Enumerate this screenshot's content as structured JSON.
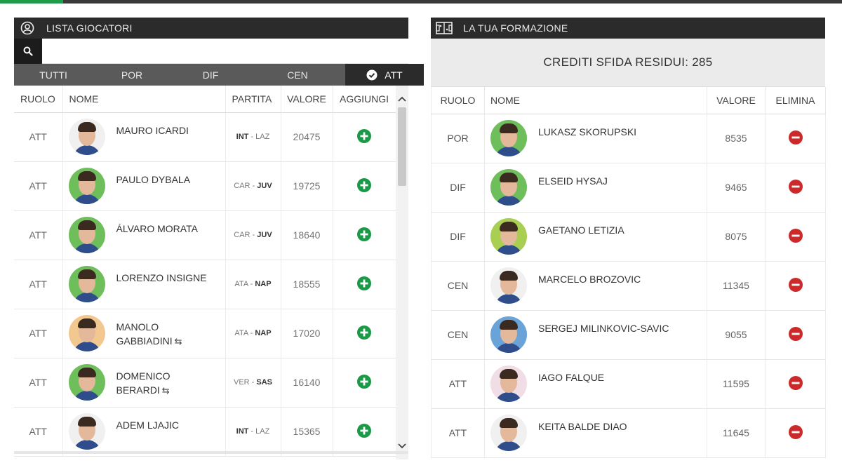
{
  "colors": {
    "accent": "#1e9c4a",
    "add": "#1a9a46",
    "remove": "#cc2a2a",
    "dark": "#2b2b2b"
  },
  "player_list": {
    "title": "LISTA GIOCATORI",
    "search_placeholder": "",
    "filters": [
      {
        "label": "TUTTI",
        "active": false
      },
      {
        "label": "POR",
        "active": false
      },
      {
        "label": "DIF",
        "active": false
      },
      {
        "label": "CEN",
        "active": false
      },
      {
        "label": "ATT",
        "active": true
      }
    ],
    "columns": [
      "RUOLO",
      "NOME",
      "PARTITA",
      "VALORE",
      "AGGIUNGI"
    ],
    "rows": [
      {
        "role": "ATT",
        "name": "MAURO ICARDI",
        "name2": "",
        "swap": false,
        "home": "INT",
        "away": "LAZ",
        "bold": "home",
        "value": "20475",
        "avatar_bg": "#f0f0f0"
      },
      {
        "role": "ATT",
        "name": "PAULO DYBALA",
        "name2": "",
        "swap": false,
        "home": "CAR",
        "away": "JUV",
        "bold": "away",
        "value": "19725",
        "avatar_bg": "#6fbe5c"
      },
      {
        "role": "ATT",
        "name": "ÁLVARO MORATA",
        "name2": "",
        "swap": false,
        "home": "CAR",
        "away": "JUV",
        "bold": "away",
        "value": "18640",
        "avatar_bg": "#6fbe5c"
      },
      {
        "role": "ATT",
        "name": "LORENZO INSIGNE",
        "name2": "",
        "swap": false,
        "home": "ATA",
        "away": "NAP",
        "bold": "away",
        "value": "18555",
        "avatar_bg": "#6fbe5c"
      },
      {
        "role": "ATT",
        "name": "MANOLO",
        "name2": "GABBIADINI",
        "swap": true,
        "home": "ATA",
        "away": "NAP",
        "bold": "away",
        "value": "17020",
        "avatar_bg": "#f2c890"
      },
      {
        "role": "ATT",
        "name": "DOMENICO",
        "name2": "BERARDI",
        "swap": true,
        "home": "VER",
        "away": "SAS",
        "bold": "away",
        "value": "16140",
        "avatar_bg": "#6fbe5c"
      },
      {
        "role": "ATT",
        "name": "ADEM LJAJIC",
        "name2": "",
        "swap": false,
        "home": "INT",
        "away": "LAZ",
        "bold": "home",
        "value": "15365",
        "avatar_bg": "#f0f0f0"
      }
    ]
  },
  "formation": {
    "title": "LA TUA FORMAZIONE",
    "credits_label": "CREDITI SFIDA RESIDUI: 285",
    "columns": [
      "RUOLO",
      "NOME",
      "VALORE",
      "ELIMINA"
    ],
    "rows": [
      {
        "role": "POR",
        "name": "LUKASZ SKORUPSKI",
        "value": "8535",
        "avatar_bg": "#6fbe5c"
      },
      {
        "role": "DIF",
        "name": "ELSEID HYSAJ",
        "value": "9465",
        "avatar_bg": "#6fbe5c"
      },
      {
        "role": "DIF",
        "name": "GAETANO LETIZIA",
        "value": "8075",
        "avatar_bg": "#a9cf52"
      },
      {
        "role": "CEN",
        "name": "MARCELO BROZOVIC",
        "value": "11345",
        "avatar_bg": "#f0f0f0"
      },
      {
        "role": "CEN",
        "name": "SERGEJ MILINKOVIC-SAVIC",
        "value": "9055",
        "avatar_bg": "#6aa3d8"
      },
      {
        "role": "ATT",
        "name": "IAGO FALQUE",
        "value": "11595",
        "avatar_bg": "#f0dde6"
      },
      {
        "role": "ATT",
        "name": "KEITA BALDE DIAO",
        "value": "11645",
        "avatar_bg": "#f0f0f0"
      }
    ]
  }
}
